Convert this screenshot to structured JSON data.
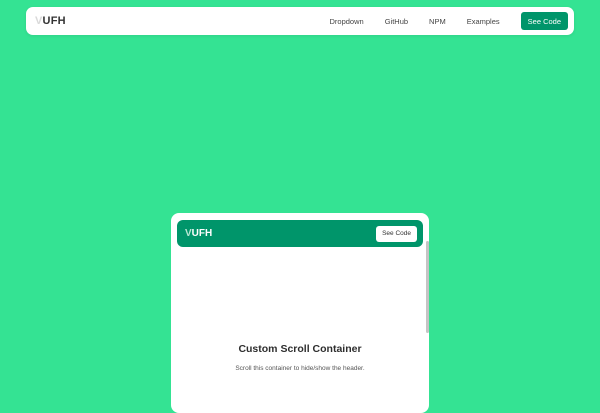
{
  "navbar": {
    "logo_v": "V",
    "logo_rest": "UFH",
    "links": [
      "Dropdown",
      "GitHub",
      "NPM",
      "Examples"
    ],
    "cta_label": "See Code"
  },
  "scroll_container": {
    "header": {
      "logo_v": "V",
      "logo_rest": "UFH",
      "button_label": "See Code"
    },
    "title": "Custom Scroll Container",
    "subtitle": "Scroll this container to hide/show the header."
  },
  "colors": {
    "background": "#34e393",
    "accent": "#00956a",
    "surface": "#ffffff"
  }
}
